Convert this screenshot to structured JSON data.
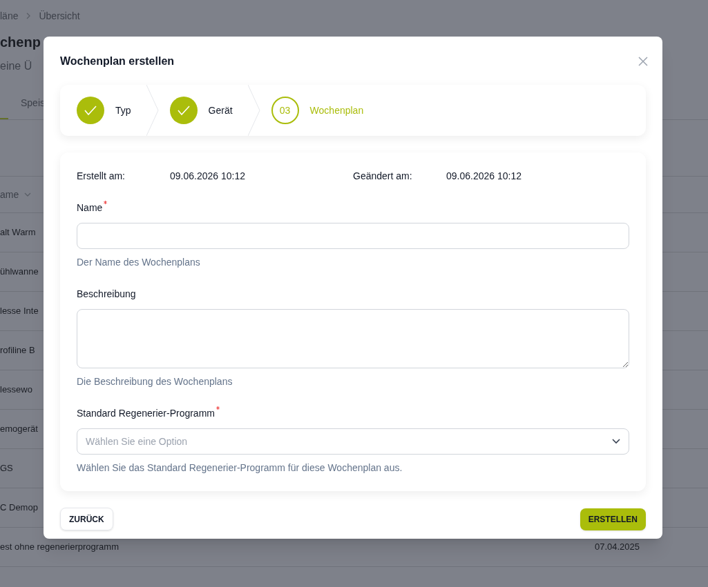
{
  "breadcrumb": [
    "läne",
    "Übersicht"
  ],
  "page_title": "chenp",
  "page_subtitle": "eine Ü",
  "tabs": [
    {
      "selected": true
    },
    {
      "label": "Speis",
      "selected": false
    }
  ],
  "table": {
    "column_1": "ame",
    "rows": [
      {
        "name": "alt Warm"
      },
      {
        "name": "ühlwanne"
      },
      {
        "name": "lesse Inte"
      },
      {
        "name": "rofiline B"
      },
      {
        "name": "lessewo"
      },
      {
        "name": "emogerät"
      },
      {
        "name": "GS"
      },
      {
        "name": "C Demop"
      },
      {
        "name": "est ohne regenerierprogramm",
        "date": "07.04.2025"
      }
    ]
  },
  "dialog": {
    "title": "Wochenplan erstellen",
    "steps": [
      {
        "label": "Typ",
        "done": true
      },
      {
        "label": "Gerät",
        "done": true
      },
      {
        "label": "Wochenplan",
        "number": "03",
        "done": false
      }
    ],
    "meta": [
      {
        "label": "Erstellt am:",
        "value": "09.06.2026 10:12"
      },
      {
        "label": "Geändert am:",
        "value": "09.06.2026 10:12"
      }
    ],
    "fields": [
      {
        "kind": "input",
        "label": "Name",
        "required": true,
        "hint": "Der Name des Wochenplans"
      },
      {
        "kind": "textarea",
        "label": "Beschreibung",
        "required": false,
        "hint": "Die Beschreibung des Wochenplans"
      },
      {
        "kind": "select",
        "label": "Standard Regenerier-Programm",
        "required": true,
        "placeholder": "Wählen Sie eine Option",
        "hint": "Wählen Sie das Standard Regenerier-Programm für diese Wochenplan aus."
      }
    ],
    "back_button": "ZURÜCK",
    "submit_button": "ERSTELLEN"
  }
}
